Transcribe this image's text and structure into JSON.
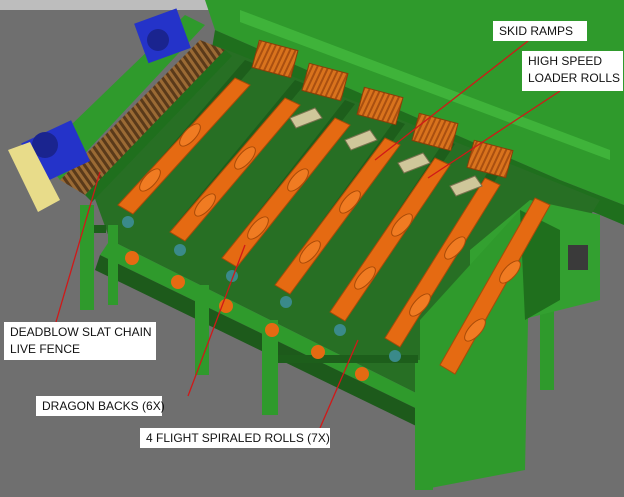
{
  "colors": {
    "background": "#6f6f6f",
    "frame_green": "#2f9a2c",
    "frame_dark": "#1f6f1d",
    "roll_orange": "#e56a12",
    "motor_blue": "#2433c9",
    "leader_red": "#d01818",
    "label_bg": "#ffffff"
  },
  "callouts": {
    "skid_ramps": "SKID RAMPS",
    "high_speed_line1": "HIGH SPEED",
    "high_speed_line2": "LOADER ROLLS",
    "deadblow_line1": "DEADBLOW SLAT CHAIN",
    "deadblow_line2": "LIVE FENCE",
    "dragon_backs": "DRAGON BACKS (6X)",
    "spiraled_rolls": "4 FLIGHT SPIRALED ROLLS (7X)"
  },
  "icons": [
    "gear-motor-icon",
    "spiral-roll-icon",
    "skid-ramp-icon",
    "loader-roll-icon"
  ]
}
